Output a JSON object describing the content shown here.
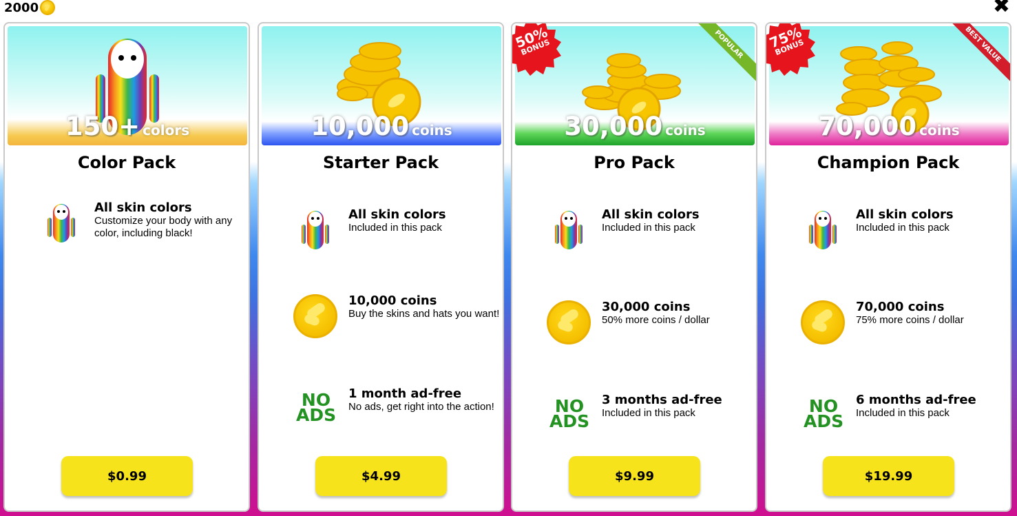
{
  "header": {
    "balance": "2000",
    "close_glyph": "✖"
  },
  "colors": {
    "buy_button": "#f6e31c",
    "no_ads_green": "#239222",
    "popular_ribbon": "#76b72a",
    "best_value_ribbon": "#d31d2a",
    "bonus_badge": "#e6141c"
  },
  "cards": [
    {
      "banner_number": "150+",
      "banner_unit": "colors",
      "title": "Color Pack",
      "features": [
        {
          "icon": "rainbow-character-icon",
          "title": "All skin colors",
          "desc": "Customize your body with any color, including black!"
        }
      ],
      "price": "$0.99"
    },
    {
      "banner_number": "10,000",
      "banner_unit": "coins",
      "title": "Starter Pack",
      "features": [
        {
          "icon": "rainbow-character-icon",
          "title": "All skin colors",
          "desc": "Included in this pack"
        },
        {
          "icon": "coin-icon",
          "title": "10,000 coins",
          "desc": "Buy the skins and hats you want!"
        },
        {
          "icon": "no-ads-icon",
          "title": "1 month ad-free",
          "desc": "No ads, get right into the action!"
        }
      ],
      "price": "$4.99"
    },
    {
      "banner_number": "30,000",
      "banner_unit": "coins",
      "title": "Pro Pack",
      "bonus_percent": "50%",
      "bonus_word": "BONUS",
      "ribbon": "POPULAR",
      "features": [
        {
          "icon": "rainbow-character-icon",
          "title": "All skin colors",
          "desc": "Included in this pack"
        },
        {
          "icon": "coin-icon",
          "title": "30,000 coins",
          "desc": "50% more coins / dollar"
        },
        {
          "icon": "no-ads-icon",
          "title": "3 months ad-free",
          "desc": "Included in this pack"
        }
      ],
      "price": "$9.99"
    },
    {
      "banner_number": "70,000",
      "banner_unit": "coins",
      "title": "Champion Pack",
      "bonus_percent": "75%",
      "bonus_word": "BONUS",
      "ribbon": "BEST VALUE",
      "features": [
        {
          "icon": "rainbow-character-icon",
          "title": "All skin colors",
          "desc": "Included in this pack"
        },
        {
          "icon": "coin-icon",
          "title": "70,000 coins",
          "desc": "75% more coins / dollar"
        },
        {
          "icon": "no-ads-icon",
          "title": "6 months ad-free",
          "desc": "Included in this pack"
        }
      ],
      "price": "$19.99"
    }
  ],
  "no_ads_text": {
    "line1": "NO",
    "line2": "ADS"
  }
}
